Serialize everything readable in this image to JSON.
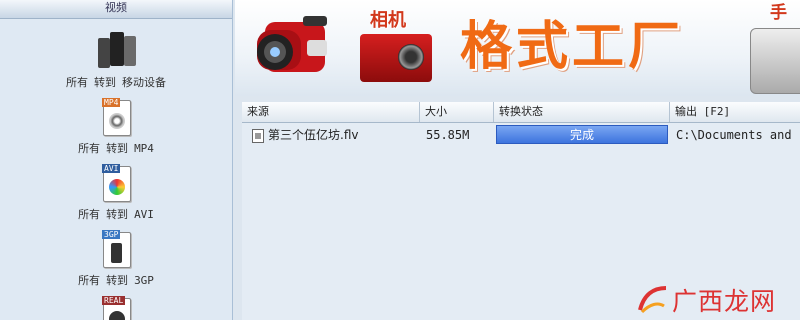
{
  "sidebar": {
    "header": "视频",
    "items": [
      {
        "icon": "mobile-device-icon",
        "words": [
          "所有",
          "转到",
          "移动设备"
        ]
      },
      {
        "icon": "mp4-file-icon",
        "tag": "MP4",
        "tag_color": "#d9722a",
        "words": [
          "所有",
          "转到",
          "MP4"
        ]
      },
      {
        "icon": "avi-file-icon",
        "tag": "AVI",
        "tag_color": "#2f5d9e",
        "words": [
          "所有",
          "转到",
          "AVI"
        ]
      },
      {
        "icon": "3gp-file-icon",
        "tag": "3GP",
        "tag_color": "#3a78c2",
        "words": [
          "所有",
          "转到",
          "3GP"
        ]
      },
      {
        "icon": "real-file-icon",
        "tag": "REAL",
        "tag_color": "#9a3030",
        "words": []
      }
    ]
  },
  "banner": {
    "camera_label": "相机",
    "title": "格式工厂",
    "right_label": "手机"
  },
  "table": {
    "columns": [
      "来源",
      "大小",
      "转换状态",
      "输出 [F2]"
    ],
    "rows": [
      {
        "source": "第三个伍亿坊.flv",
        "size": "55.85M",
        "status": "完成",
        "output": "C:\\Documents and"
      }
    ]
  },
  "watermark": {
    "text": "广西龙网"
  },
  "colors": {
    "accent_orange": "#f06a14",
    "status_blue": "#3d74de",
    "brand_red": "#d2381c"
  }
}
